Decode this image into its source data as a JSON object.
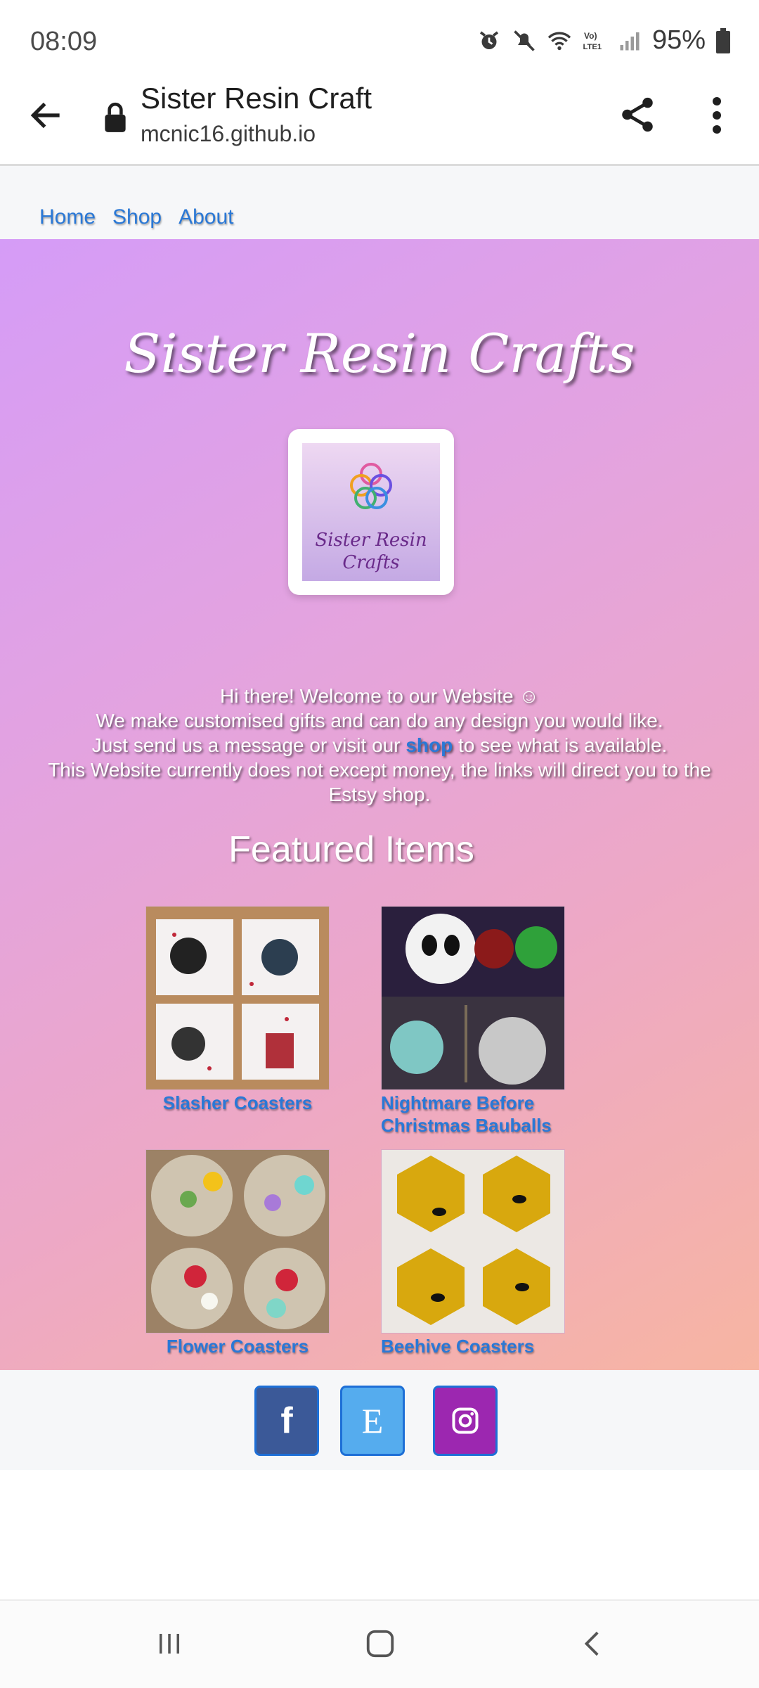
{
  "status_bar": {
    "time": "08:09",
    "battery": "95%",
    "icons": [
      "alarm-icon",
      "mute-icon",
      "wifi-icon",
      "volte-icon",
      "signal-icon",
      "battery-icon"
    ]
  },
  "browser": {
    "page_title": "Sister Resin Craft",
    "host": "mcnic16.github.io"
  },
  "nav": {
    "links": [
      "Home",
      "Shop",
      "About"
    ]
  },
  "hero": {
    "title": "Sister Resin Crafts",
    "logo_text": [
      "Sister Resin",
      "Crafts"
    ],
    "welcome_lines": [
      "Hi there! Welcome to our Website ☺",
      "We make customised gifts and can do any design you would like."
    ],
    "welcome_prefix": "Just send us a message or visit our",
    "shop_link": "shop",
    "welcome_suffix": "to see what is available.",
    "welcome_note": "This Website currently does not except money, the links will direct you to the Estsy shop."
  },
  "featured": {
    "heading": "Featured Items",
    "items": [
      {
        "label": "Slasher Coasters"
      },
      {
        "label": "Nightmare Before Christmas Bauballs"
      },
      {
        "label": "Flower Coasters"
      },
      {
        "label": "Beehive Coasters"
      }
    ]
  },
  "footer": {
    "facebook": "f",
    "etsy": "E",
    "colors": {
      "facebook": "#3b5998",
      "etsy": "#55acee",
      "instagram": "#9c27b0"
    }
  }
}
